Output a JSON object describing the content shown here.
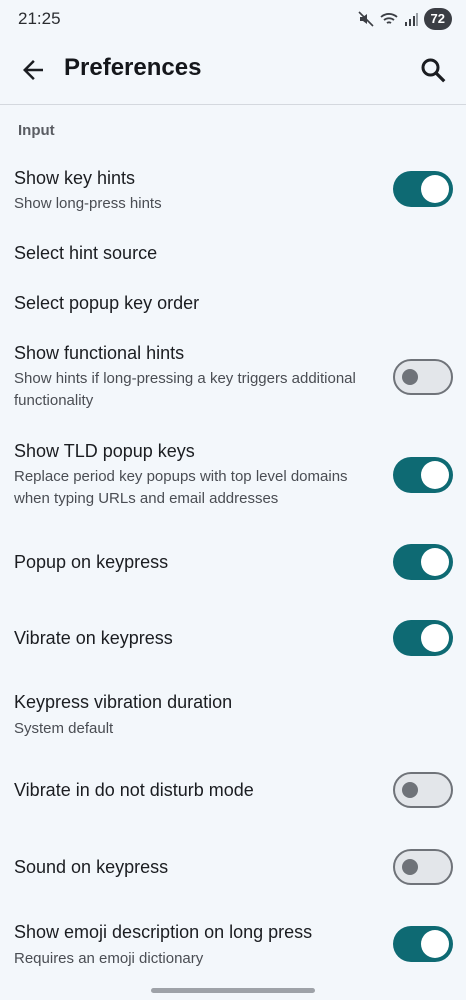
{
  "status": {
    "time": "21:25",
    "battery": "72"
  },
  "appbar": {
    "title": "Preferences"
  },
  "section": "Input",
  "settings": [
    {
      "title": "Show key hints",
      "subtitle": "Show long-press hints",
      "toggle": true
    },
    {
      "title": "Select hint source"
    },
    {
      "title": "Select popup key order"
    },
    {
      "title": "Show functional hints",
      "subtitle": "Show hints if long-pressing a key triggers additional functionality",
      "toggle": false
    },
    {
      "title": "Show TLD popup keys",
      "subtitle": "Replace period key popups with top level domains when typing URLs and email addresses",
      "toggle": true
    },
    {
      "title": "Popup on keypress",
      "toggle": true
    },
    {
      "title": "Vibrate on keypress",
      "toggle": true
    },
    {
      "title": "Keypress vibration duration",
      "subtitle": "System default"
    },
    {
      "title": "Vibrate in do not disturb mode",
      "toggle": false
    },
    {
      "title": "Sound on keypress",
      "toggle": false
    },
    {
      "title": "Show emoji description on long press",
      "subtitle": "Requires an emoji dictionary",
      "toggle": true
    }
  ]
}
